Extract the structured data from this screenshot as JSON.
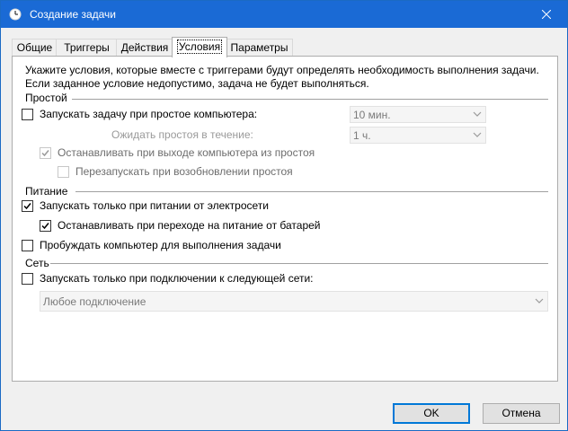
{
  "window": {
    "title": "Создание задачи"
  },
  "tabs": [
    {
      "label": "Общие"
    },
    {
      "label": "Триггеры"
    },
    {
      "label": "Действия"
    },
    {
      "label": "Условия"
    },
    {
      "label": "Параметры"
    }
  ],
  "active_tab": "Условия",
  "intro": {
    "line1": "Укажите условия, которые вместе с триггерами будут определять необходимость выполнения задачи.",
    "line2": "Если заданное условие недопустимо, задача не будет выполняться."
  },
  "idle": {
    "group_label": "Простой",
    "start_if_idle": {
      "label": "Запускать задачу при простое компьютера:",
      "checked": false,
      "enabled": true
    },
    "idle_for_value": "10 мин.",
    "wait_label": "Ожидать простоя в течение:",
    "wait_value": "1 ч.",
    "stop_on_resume": {
      "label": "Останавливать при выходе компьютера из простоя",
      "checked": true,
      "enabled": false
    },
    "restart_if_idle_resumes": {
      "label": "Перезапускать при возобновлении простоя",
      "checked": false,
      "enabled": false
    }
  },
  "power": {
    "group_label": "Питание",
    "ac_only": {
      "label": "Запускать только при питании от электросети",
      "checked": true,
      "enabled": true
    },
    "stop_on_battery": {
      "label": "Останавливать при переходе на питание от батарей",
      "checked": true,
      "enabled": true
    },
    "wake_to_run": {
      "label": "Пробуждать компьютер для выполнения задачи",
      "checked": false,
      "enabled": true
    }
  },
  "network": {
    "group_label": "Сеть",
    "network_only": {
      "label": "Запускать только при подключении к следующей сети:",
      "checked": false,
      "enabled": true
    },
    "connection_value": "Любое подключение"
  },
  "buttons": {
    "ok": "OK",
    "cancel": "Отмена"
  },
  "colors": {
    "titlebar": "#1a6ad5",
    "accent": "#0078d7",
    "disabled_text": "#9a9a9a"
  }
}
